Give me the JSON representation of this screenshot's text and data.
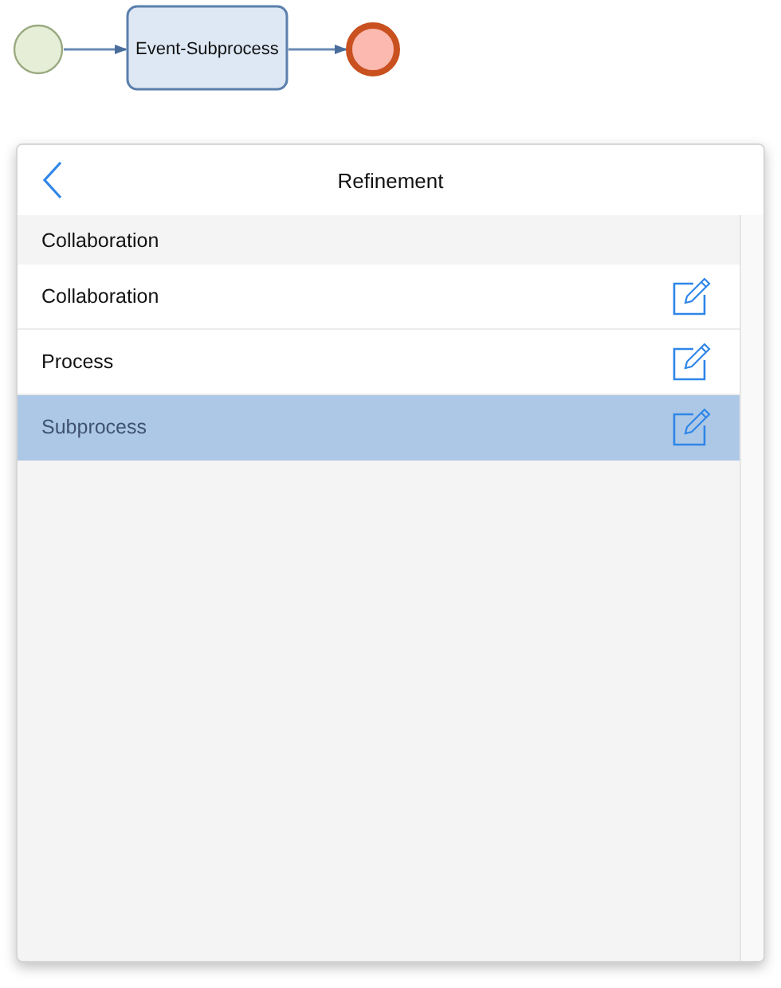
{
  "diagram": {
    "task": {
      "label": "Event-Subprocess"
    }
  },
  "panel": {
    "title": "Refinement",
    "section": "Collaboration",
    "items": [
      {
        "label": "Collaboration",
        "selected": false
      },
      {
        "label": "Process",
        "selected": false
      },
      {
        "label": "Subprocess",
        "selected": true
      }
    ]
  }
}
